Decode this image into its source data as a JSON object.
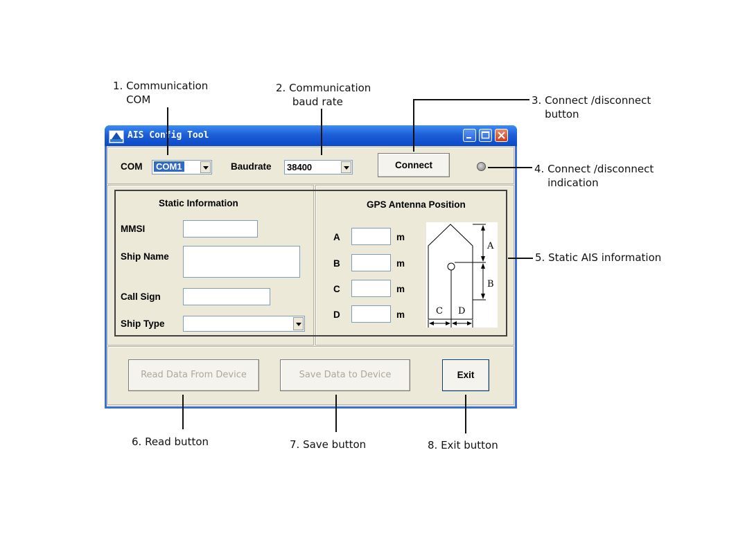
{
  "callouts": {
    "c1": "1. Communication\n    COM",
    "c2": "2. Communication\n     baud rate",
    "c3": "3. Connect /disconnect\n    button",
    "c4": "4. Connect /disconnect\n    indication",
    "c5": "5. Static AIS information",
    "c6": "6. Read button",
    "c7": "7. Save button",
    "c8": "8. Exit button"
  },
  "window": {
    "title": "AIS Config Tool"
  },
  "connection": {
    "com_label": "COM",
    "com_value": "COM1",
    "baud_label": "Baudrate",
    "baud_value": "38400",
    "connect_button": "Connect"
  },
  "static_info": {
    "title": "Static Information",
    "mmsi_label": "MMSI",
    "ship_name_label": "Ship Name",
    "call_sign_label": "Call Sign",
    "ship_type_label": "Ship Type"
  },
  "gps": {
    "title": "GPS Antenna Position",
    "rows": [
      {
        "label": "A",
        "unit": "m"
      },
      {
        "label": "B",
        "unit": "m"
      },
      {
        "label": "C",
        "unit": "m"
      },
      {
        "label": "D",
        "unit": "m"
      }
    ],
    "diagram_labels": {
      "a": "A",
      "b": "B",
      "c": "C",
      "d": "D"
    }
  },
  "actions": {
    "read_button": "Read Data From Device",
    "save_button": "Save Data to Device",
    "exit_button": "Exit"
  },
  "colors": {
    "titlebar": "#0b49c9",
    "client_bg": "#ece9d8",
    "disabled_text": "#aca899"
  }
}
